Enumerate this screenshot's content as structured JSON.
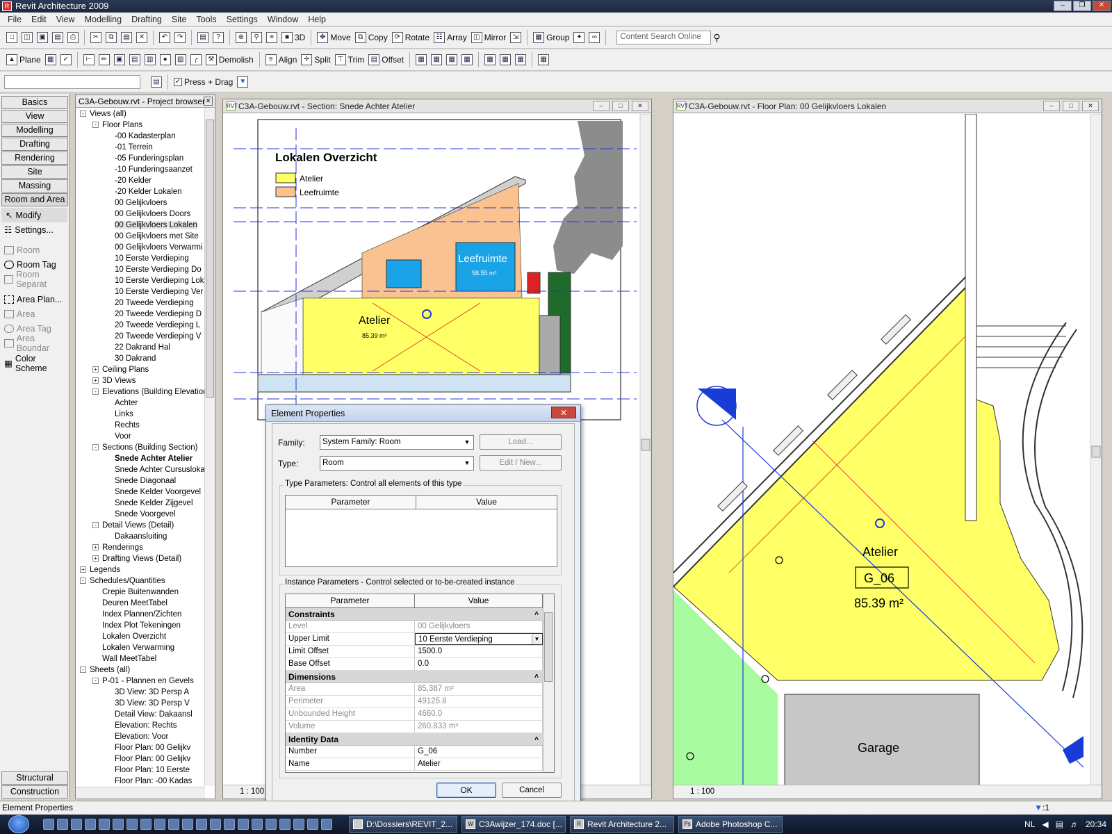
{
  "app": {
    "title": "Revit Architecture 2009"
  },
  "menu": [
    "File",
    "Edit",
    "View",
    "Modelling",
    "Drafting",
    "Site",
    "Tools",
    "Settings",
    "Window",
    "Help"
  ],
  "toolbar1": {
    "view_3d": "3D",
    "move": "Move",
    "copy": "Copy",
    "rotate": "Rotate",
    "array": "Array",
    "mirror": "Mirror",
    "group": "Group",
    "search_placeholder": "Content Search Online"
  },
  "toolbar2": {
    "plane": "Plane",
    "demolish": "Demolish",
    "align": "Align",
    "split": "Split",
    "trim": "Trim",
    "offset": "Offset"
  },
  "toolbar3": {
    "press_drag": "Press + Drag"
  },
  "designbar": {
    "tabs": [
      "Basics",
      "View",
      "Modelling",
      "Drafting",
      "Rendering",
      "Site",
      "Massing",
      "Room and Area"
    ],
    "modify": "Modify",
    "settings": "Settings...",
    "room": "Room",
    "room_tag": "Room Tag",
    "room_separation": "Room Separat",
    "area_plan": "Area Plan...",
    "area": "Area",
    "area_tag": "Area Tag",
    "area_boundary": "Area Boundar",
    "color_scheme": "Color Scheme",
    "bottom_tabs": [
      "Structural",
      "Construction"
    ]
  },
  "browser": {
    "title": "C3A-Gebouw.rvt - Project browser",
    "nodes": [
      {
        "label": "Views (all)",
        "lvl": 0,
        "exp": "-"
      },
      {
        "label": "Floor Plans",
        "lvl": 1,
        "exp": "-"
      },
      {
        "label": "-00 Kadasterplan",
        "lvl": 2
      },
      {
        "label": "-01 Terrein",
        "lvl": 2
      },
      {
        "label": "-05 Funderingsplan",
        "lvl": 2
      },
      {
        "label": "-10 Funderingsaanzet",
        "lvl": 2
      },
      {
        "label": "-20 Kelder",
        "lvl": 2
      },
      {
        "label": "-20 Kelder Lokalen",
        "lvl": 2
      },
      {
        "label": "00 Gelijkvloers",
        "lvl": 2
      },
      {
        "label": "00 Gelijkvloers Doors",
        "lvl": 2
      },
      {
        "label": "00 Gelijkvloers Lokalen",
        "lvl": 2,
        "sel": true
      },
      {
        "label": "00 Gelijkvloers met Site",
        "lvl": 2
      },
      {
        "label": "00 Gelijkvloers Verwarmi",
        "lvl": 2
      },
      {
        "label": "10 Eerste Verdieping",
        "lvl": 2
      },
      {
        "label": "10 Eerste Verdieping Do",
        "lvl": 2
      },
      {
        "label": "10 Eerste Verdieping Lok",
        "lvl": 2
      },
      {
        "label": "10 Eerste Verdieping Ver",
        "lvl": 2
      },
      {
        "label": "20 Tweede Verdieping",
        "lvl": 2
      },
      {
        "label": "20 Tweede Verdieping D",
        "lvl": 2
      },
      {
        "label": "20 Tweede Verdieping L",
        "lvl": 2
      },
      {
        "label": "20 Tweede Verdieping V",
        "lvl": 2
      },
      {
        "label": "22 Dakrand Hal",
        "lvl": 2
      },
      {
        "label": "30 Dakrand",
        "lvl": 2
      },
      {
        "label": "Ceiling Plans",
        "lvl": 1,
        "exp": "+"
      },
      {
        "label": "3D Views",
        "lvl": 1,
        "exp": "+"
      },
      {
        "label": "Elevations (Building Elevation)",
        "lvl": 1,
        "exp": "-"
      },
      {
        "label": "Achter",
        "lvl": 2
      },
      {
        "label": "Links",
        "lvl": 2
      },
      {
        "label": "Rechts",
        "lvl": 2
      },
      {
        "label": "Voor",
        "lvl": 2
      },
      {
        "label": "Sections (Building Section)",
        "lvl": 1,
        "exp": "-"
      },
      {
        "label": "Snede Achter Atelier",
        "lvl": 2,
        "bold": true
      },
      {
        "label": "Snede Achter Cursuslokaal",
        "lvl": 2
      },
      {
        "label": "Snede Diagonaal",
        "lvl": 2
      },
      {
        "label": "Snede Kelder Voorgevel",
        "lvl": 2
      },
      {
        "label": "Snede Kelder Zijgevel",
        "lvl": 2
      },
      {
        "label": "Snede Voorgevel",
        "lvl": 2
      },
      {
        "label": "Detail Views (Detail)",
        "lvl": 1,
        "exp": "-"
      },
      {
        "label": "Dakaansluiting",
        "lvl": 2
      },
      {
        "label": "Renderings",
        "lvl": 1,
        "exp": "+"
      },
      {
        "label": "Drafting Views (Detail)",
        "lvl": 1,
        "exp": "+"
      },
      {
        "label": "Legends",
        "lvl": 0,
        "exp": "+"
      },
      {
        "label": "Schedules/Quantities",
        "lvl": 0,
        "exp": "-"
      },
      {
        "label": "Crepie Buitenwanden",
        "lvl": 1
      },
      {
        "label": "Deuren MeetTabel",
        "lvl": 1
      },
      {
        "label": "Index Plannen/Zichten",
        "lvl": 1
      },
      {
        "label": "Index Plot Tekeningen",
        "lvl": 1
      },
      {
        "label": "Lokalen Overzicht",
        "lvl": 1
      },
      {
        "label": "Lokalen Verwarming",
        "lvl": 1
      },
      {
        "label": "Wall MeetTabel",
        "lvl": 1
      },
      {
        "label": "Sheets (all)",
        "lvl": 0,
        "exp": "-"
      },
      {
        "label": "P-01 - Plannen en Gevels",
        "lvl": 1,
        "exp": "-"
      },
      {
        "label": "3D View: 3D Persp A",
        "lvl": 2
      },
      {
        "label": "3D View: 3D Persp V",
        "lvl": 2
      },
      {
        "label": "Detail View: Dakaansl",
        "lvl": 2
      },
      {
        "label": "Elevation: Rechts",
        "lvl": 2
      },
      {
        "label": "Elevation: Voor",
        "lvl": 2
      },
      {
        "label": "Floor Plan: 00 Gelijkv",
        "lvl": 2
      },
      {
        "label": "Floor Plan: 00 Gelijkv",
        "lvl": 2
      },
      {
        "label": "Floor Plan: 10 Eerste",
        "lvl": 2
      },
      {
        "label": "Floor Plan: -00 Kadas",
        "lvl": 2
      }
    ]
  },
  "section_view": {
    "title": "C3A-Gebouw.rvt - Section: Snede Achter Atelier",
    "legend_title": "Lokalen Overzicht",
    "legend_items": [
      {
        "label": "Atelier",
        "color": "#ffff66"
      },
      {
        "label": "Leefruimte",
        "color": "#f9c290"
      }
    ],
    "room_atelier": "Atelier",
    "room_atelier_area": "85.39 m²",
    "room_leefruimte": "Leefruimte",
    "room_leefruimte_area": "58.55 m²",
    "scale": "1 : 100"
  },
  "plan_view": {
    "title": "C3A-Gebouw.rvt - Floor Plan: 00 Gelijkvloers Lokalen",
    "room_name": "Atelier",
    "room_number": "G_06",
    "room_area": "85.39 m²",
    "garage": "Garage",
    "scale": "1 : 100"
  },
  "dialog": {
    "title": "Element Properties",
    "family_label": "Family:",
    "family_value": "System Family: Room",
    "type_label": "Type:",
    "type_value": "Room",
    "load": "Load...",
    "edit_new": "Edit / New...",
    "type_params_title": "Type Parameters: Control all elements of this type",
    "instance_params_title": "Instance Parameters - Control selected or to-be-created instance",
    "col_parameter": "Parameter",
    "col_value": "Value",
    "sections": [
      {
        "name": "Constraints",
        "rows": [
          {
            "p": "Level",
            "v": "00 Gelijkvloers",
            "dis": true
          },
          {
            "p": "Upper Limit",
            "v": "10 Eerste Verdieping",
            "combo": true
          },
          {
            "p": "Limit Offset",
            "v": "1500.0"
          },
          {
            "p": "Base Offset",
            "v": "0.0"
          }
        ]
      },
      {
        "name": "Dimensions",
        "rows": [
          {
            "p": "Area",
            "v": "85.387 m²",
            "dis": true
          },
          {
            "p": "Perimeter",
            "v": "49125.8",
            "dis": true
          },
          {
            "p": "Unbounded Height",
            "v": "4660.0",
            "dis": true
          },
          {
            "p": "Volume",
            "v": "260.833 m³",
            "dis": true
          }
        ]
      },
      {
        "name": "Identity Data",
        "rows": [
          {
            "p": "Number",
            "v": "G_06"
          },
          {
            "p": "Name",
            "v": "Atelier"
          }
        ]
      }
    ],
    "ok": "OK",
    "cancel": "Cancel"
  },
  "statusbar": {
    "text": "Element Properties",
    "filter": ":1"
  },
  "taskbar": {
    "tasks": [
      {
        "label": "D:\\Dossiers\\REVIT_2...",
        "icon": "folder-icon"
      },
      {
        "label": "C3Awijzer_174.doc [...",
        "icon": "word-icon"
      },
      {
        "label": "Revit Architecture 2...",
        "icon": "revit-icon"
      },
      {
        "label": "Adobe Photoshop C...",
        "icon": "photoshop-icon"
      }
    ],
    "lang": "NL",
    "clock": "20:34"
  }
}
